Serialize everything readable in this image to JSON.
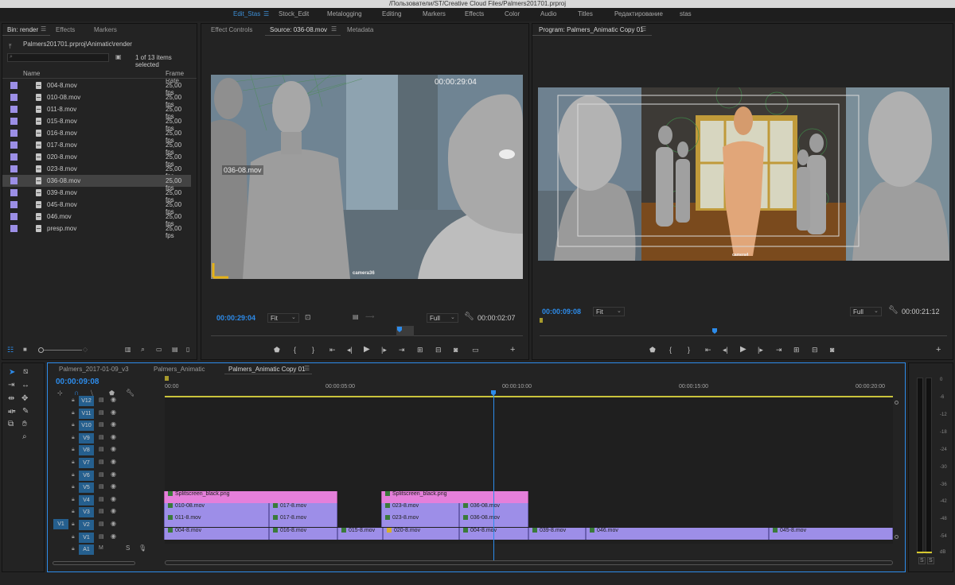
{
  "window": {
    "title": "/Пользователи/ST/Creative Cloud Files/Palmers201701.prproj"
  },
  "workspaces": [
    {
      "label": "Edit_Stas",
      "active": true
    },
    {
      "label": "Stock_Edit"
    },
    {
      "label": "Metalogging"
    },
    {
      "label": "Editing"
    },
    {
      "label": "Markers"
    },
    {
      "label": "Effects"
    },
    {
      "label": "Color"
    },
    {
      "label": "Audio"
    },
    {
      "label": "Titles"
    },
    {
      "label": "Редактирование"
    },
    {
      "label": "stas"
    }
  ],
  "project": {
    "tabs": [
      "Bin: render",
      "Effects",
      "Markers"
    ],
    "path": "Palmers201701.prproj\\Animatic\\render",
    "selection": "1 of 13 items selected",
    "col_name": "Name",
    "col_fps": "Frame Rate",
    "items": [
      {
        "name": "004-8.mov",
        "fps": "25,00 fps"
      },
      {
        "name": "010-08.mov",
        "fps": "25,00 fps"
      },
      {
        "name": "011-8.mov",
        "fps": "25,00 fps"
      },
      {
        "name": "015-8.mov",
        "fps": "25,00 fps"
      },
      {
        "name": "016-8.mov",
        "fps": "25,00 fps"
      },
      {
        "name": "017-8.mov",
        "fps": "25,00 fps"
      },
      {
        "name": "020-8.mov",
        "fps": "25,00 fps"
      },
      {
        "name": "023-8.mov",
        "fps": "25,00 fps"
      },
      {
        "name": "036-08.mov",
        "fps": "25,00 fps"
      },
      {
        "name": "039-8.mov",
        "fps": "25,00 fps"
      },
      {
        "name": "045-8.mov",
        "fps": "25,00 fps"
      },
      {
        "name": "046.mov",
        "fps": "25,00 fps"
      },
      {
        "name": "presp.mov",
        "fps": "25,00 fps"
      }
    ]
  },
  "source": {
    "tabs": [
      "Effect Controls",
      "Source: 036-08.mov",
      "Metadata"
    ],
    "overlay_tc": "00:00:29:04",
    "clip_label": "036-08.mov",
    "camera_label": "camera36",
    "tc_in": "00:00:29:04",
    "fit": "Fit",
    "quality": "Full",
    "duration": "00:00:02:07"
  },
  "program": {
    "title": "Program: Palmers_Animatic Copy 01",
    "camera_label": "camera4",
    "tc": "00:00:09:08",
    "fit": "Fit",
    "quality": "Full",
    "duration": "00:00:21:12"
  },
  "timeline": {
    "tabs": [
      "Palmers_2017-01-09_v3",
      "Palmers_Animatic",
      "Palmers_Animatic Copy 01"
    ],
    "tc": "00:00:09:08",
    "ruler": [
      "00:00",
      "00:00:05:00",
      "00:00:10:00",
      "00:00:15:00",
      "00:00:20:00"
    ],
    "video_tracks": [
      "V12",
      "V11",
      "V10",
      "V9",
      "V8",
      "V7",
      "V6",
      "V5",
      "V4",
      "V3",
      "V2",
      "V1"
    ],
    "audio_tracks": [
      "A1"
    ],
    "source_patch": "V1",
    "mute": "M",
    "solo": "S",
    "clips": {
      "v4_a": "Splitscreen_black.png",
      "v4_b": "Splitscreen_black.png",
      "v3": [
        "010-08.mov",
        "017-8.mov",
        "023-8.mov",
        "036-08.mov"
      ],
      "v2": [
        "011-8.mov",
        "017-8.mov",
        "023-8.mov",
        "036-08.mov"
      ],
      "v1": [
        "004-8.mov",
        "016-8.mov",
        "015-8.mov",
        "020-8.mov",
        "004-8.mov",
        "039-8.mov",
        "046.mov",
        "045-8.mov"
      ]
    }
  },
  "meter": {
    "labels": [
      "0",
      "-6",
      "-12",
      "-18",
      "-24",
      "-30",
      "-36",
      "-42",
      "-48",
      "-54",
      "dB"
    ],
    "solo": "S"
  },
  "colors": {
    "accent": "#2d8ceb",
    "clip": "#9d8ee8",
    "clip_pink": "#e57fda",
    "track_active": "#255f8e"
  }
}
